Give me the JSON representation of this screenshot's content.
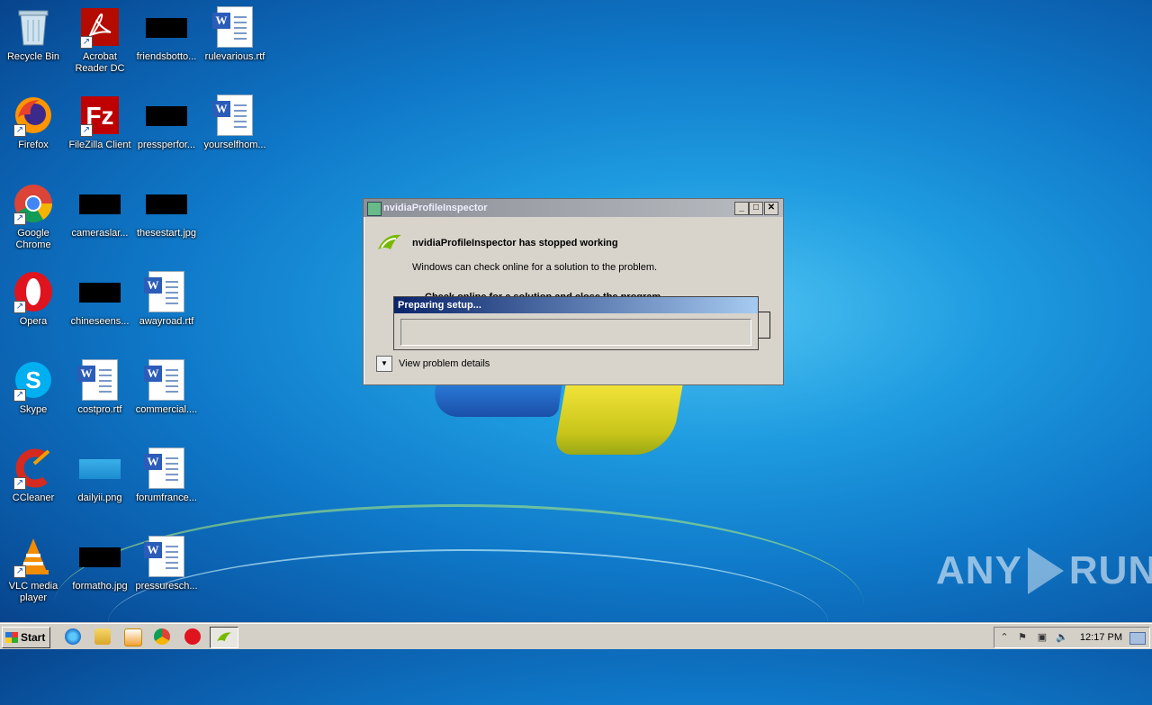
{
  "desktop": {
    "icons": [
      {
        "label": "Recycle Bin",
        "icon": "recycle-bin-icon"
      },
      {
        "label": "Acrobat\nReader DC",
        "icon": "acrobat-icon"
      },
      {
        "label": "friendsbotto...",
        "icon": "image-file-icon"
      },
      {
        "label": "rulevarious.rtf",
        "icon": "word-doc-icon"
      },
      {
        "label": "Firefox",
        "icon": "firefox-icon"
      },
      {
        "label": "FileZilla Client",
        "icon": "filezilla-icon"
      },
      {
        "label": "pressperfor...",
        "icon": "image-file-icon"
      },
      {
        "label": "yourselfhom...",
        "icon": "word-doc-icon"
      },
      {
        "label": "Google\nChrome",
        "icon": "chrome-icon"
      },
      {
        "label": "cameraslar...",
        "icon": "image-file-icon"
      },
      {
        "label": "thesestart.jpg",
        "icon": "image-file-icon"
      },
      {
        "label": "Opera",
        "icon": "opera-icon"
      },
      {
        "label": "chineseens...",
        "icon": "image-file-icon"
      },
      {
        "label": "awayroad.rtf",
        "icon": "word-doc-icon"
      },
      {
        "label": "Skype",
        "icon": "skype-icon"
      },
      {
        "label": "costpro.rtf",
        "icon": "word-doc-icon"
      },
      {
        "label": "commercial....",
        "icon": "word-doc-icon"
      },
      {
        "label": "CCleaner",
        "icon": "ccleaner-icon"
      },
      {
        "label": "dailyii.png",
        "icon": "image-file-icon"
      },
      {
        "label": "forumfrance...",
        "icon": "word-doc-icon"
      },
      {
        "label": "VLC media\nplayer",
        "icon": "vlc-icon"
      },
      {
        "label": "formatho.jpg",
        "icon": "image-file-icon"
      },
      {
        "label": "pressuresch...",
        "icon": "word-doc-icon"
      }
    ]
  },
  "dialog": {
    "title": "nvidiaProfileInspector",
    "heading": "nvidiaProfileInspector has stopped working",
    "message": "Windows can check online for a solution to the problem.",
    "option_partial": "Check online for a solution and close the program",
    "details_label": "View problem details",
    "minimize": "_",
    "maximize": "□",
    "close": "✕"
  },
  "setup_popup": {
    "title": "Preparing setup...",
    "progress": 0
  },
  "watermark": {
    "left": "ANY",
    "right": "RUN"
  },
  "taskbar": {
    "start_label": "Start",
    "quicklaunch": [
      "ie-icon",
      "explorer-icon",
      "media-player-icon",
      "chrome-icon",
      "opera-icon"
    ],
    "active_task": "nvidiaProfileInspector",
    "clock": "12:17 PM"
  },
  "colors": {
    "dialog_bg": "#d8d4cc",
    "setup_title_start": "#0a246a",
    "setup_title_end": "#a6caf0",
    "taskbar_bg": "#d4d0c8"
  }
}
